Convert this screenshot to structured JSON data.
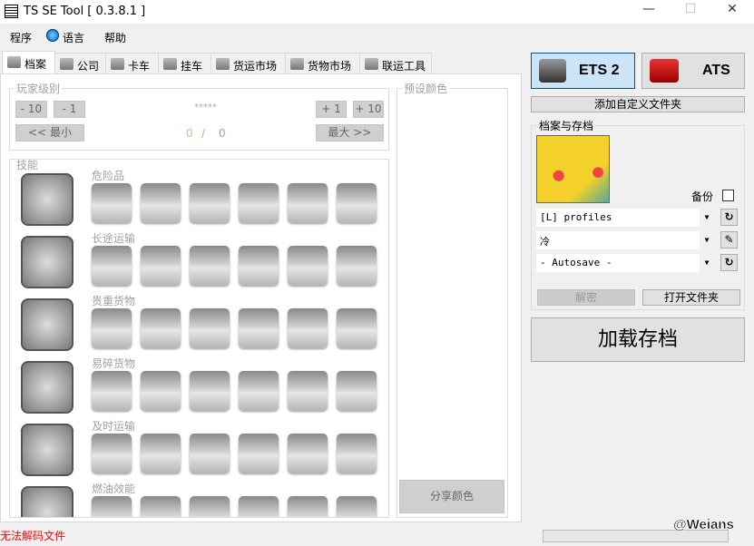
{
  "window": {
    "title": "TS SE Tool [ 0.3.8.1 ]",
    "minimize": "—",
    "maximize": "☐",
    "close": "✕"
  },
  "menu": {
    "items": [
      "程序",
      "语言",
      "帮助"
    ]
  },
  "tabs": [
    "档案",
    "公司",
    "卡车",
    "挂车",
    "货运市场",
    "货物市场",
    "联运工具"
  ],
  "player_level": {
    "label": "玩家级别",
    "minus10": "- 10",
    "minus1": "- 1",
    "stars": "*****",
    "plus1": "+ 1",
    "plus10": "+ 10",
    "min": "<< 最小",
    "max": "最大 >>",
    "current": "0",
    "separator": "/",
    "total": "0"
  },
  "skills": {
    "label": "技能",
    "rows": [
      "危险品",
      "长途运输",
      "贵重货物",
      "易碎货物",
      "及时运输",
      "燃油效能"
    ]
  },
  "preset_colors": {
    "label": "预设颜色",
    "share": "分享颜色"
  },
  "games": {
    "ets2": "ETS 2",
    "ats": "ATS",
    "selected": "ETS 2"
  },
  "add_folder": "添加自定义文件夹",
  "profiles": {
    "label": "档案与存档",
    "backup": "备份",
    "backup_checked": false,
    "folder": "[L] profiles",
    "profile": "冷",
    "save": "- Autosave -",
    "decrypt": "解密",
    "open_folder": "打开文件夹"
  },
  "load_save": "加载存档",
  "status": {
    "message": "无法解码文件",
    "message_color": "#ff0000",
    "watermark": "@Weians"
  }
}
